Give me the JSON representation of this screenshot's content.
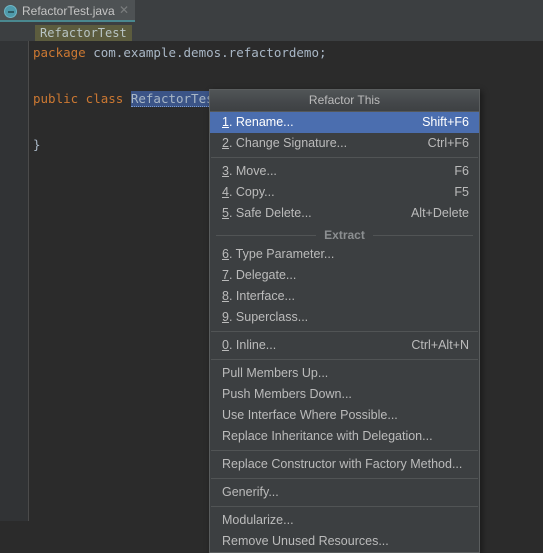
{
  "editor": {
    "tab": {
      "label": "RefactorTest.java",
      "icon": "java-class-icon",
      "close_icon": "close-icon",
      "accent_color": "#4a888f"
    },
    "breadcrumb": {
      "label": "RefactorTest",
      "highlight_color": "#5c5c3e"
    },
    "code_lines": [
      {
        "parts": [
          {
            "text": "package",
            "style": "kw"
          },
          {
            "text": " com.example.demos.refactordemo;",
            "style": "plain"
          }
        ]
      },
      {
        "parts": []
      },
      {
        "parts": [
          {
            "text": "public class",
            "style": "kw"
          },
          {
            "text": " ",
            "style": "plain"
          },
          {
            "text": "RefactorTest",
            "style": "sel"
          },
          {
            "text": " {",
            "style": "plain"
          }
        ]
      },
      {
        "parts": []
      },
      {
        "parts": [
          {
            "text": "}",
            "style": "plain"
          }
        ]
      }
    ]
  },
  "menu": {
    "title": "Refactor This",
    "selected_index": 0,
    "highlight_color": "#4b6eaf",
    "items": [
      {
        "type": "item",
        "mnemonic": "1",
        "label": ". Rename...",
        "shortcut": "Shift+F6",
        "selected": true,
        "name": "menu-item-rename"
      },
      {
        "type": "item",
        "mnemonic": "2",
        "label": ". Change Signature...",
        "shortcut": "Ctrl+F6",
        "selected": false,
        "name": "menu-item-change-signature"
      },
      {
        "type": "separator",
        "name": "menu-separator-1"
      },
      {
        "type": "item",
        "mnemonic": "3",
        "label": ". Move...",
        "shortcut": "F6",
        "selected": false,
        "name": "menu-item-move"
      },
      {
        "type": "item",
        "mnemonic": "4",
        "label": ". Copy...",
        "shortcut": "F5",
        "selected": false,
        "name": "menu-item-copy"
      },
      {
        "type": "item",
        "mnemonic": "5",
        "label": ". Safe Delete...",
        "shortcut": "Alt+Delete",
        "selected": false,
        "name": "menu-item-safe-delete"
      },
      {
        "type": "separator-labeled",
        "label": "Extract",
        "name": "menu-separator-extract"
      },
      {
        "type": "item",
        "mnemonic": "6",
        "label": ". Type Parameter...",
        "shortcut": "",
        "selected": false,
        "name": "menu-item-type-parameter"
      },
      {
        "type": "item",
        "mnemonic": "7",
        "label": ". Delegate...",
        "shortcut": "",
        "selected": false,
        "name": "menu-item-delegate"
      },
      {
        "type": "item",
        "mnemonic": "8",
        "label": ". Interface...",
        "shortcut": "",
        "selected": false,
        "name": "menu-item-interface"
      },
      {
        "type": "item",
        "mnemonic": "9",
        "label": ". Superclass...",
        "shortcut": "",
        "selected": false,
        "name": "menu-item-superclass"
      },
      {
        "type": "separator",
        "name": "menu-separator-2"
      },
      {
        "type": "item",
        "mnemonic": "0",
        "label": ". Inline...",
        "shortcut": "Ctrl+Alt+N",
        "selected": false,
        "name": "menu-item-inline"
      },
      {
        "type": "separator",
        "name": "menu-separator-3"
      },
      {
        "type": "item",
        "mnemonic": "",
        "label": "Pull Members Up...",
        "shortcut": "",
        "selected": false,
        "name": "menu-item-pull-members-up"
      },
      {
        "type": "item",
        "mnemonic": "",
        "label": "Push Members Down...",
        "shortcut": "",
        "selected": false,
        "name": "menu-item-push-members-down"
      },
      {
        "type": "item",
        "mnemonic": "",
        "label": "Use Interface Where Possible...",
        "shortcut": "",
        "selected": false,
        "name": "menu-item-use-interface-where-possible"
      },
      {
        "type": "item",
        "mnemonic": "",
        "label": "Replace Inheritance with Delegation...",
        "shortcut": "",
        "selected": false,
        "name": "menu-item-replace-inheritance-with-delegation"
      },
      {
        "type": "separator",
        "name": "menu-separator-4"
      },
      {
        "type": "item",
        "mnemonic": "",
        "label": "Replace Constructor with Factory Method...",
        "shortcut": "",
        "selected": false,
        "name": "menu-item-replace-constructor-with-factory-method"
      },
      {
        "type": "separator",
        "name": "menu-separator-5"
      },
      {
        "type": "item",
        "mnemonic": "",
        "label": "Generify...",
        "shortcut": "",
        "selected": false,
        "name": "menu-item-generify"
      },
      {
        "type": "separator",
        "name": "menu-separator-6"
      },
      {
        "type": "item",
        "mnemonic": "",
        "label": "Modularize...",
        "shortcut": "",
        "selected": false,
        "name": "menu-item-modularize"
      },
      {
        "type": "item",
        "mnemonic": "",
        "label": "Remove Unused Resources...",
        "shortcut": "",
        "selected": false,
        "name": "menu-item-remove-unused-resources"
      }
    ]
  }
}
